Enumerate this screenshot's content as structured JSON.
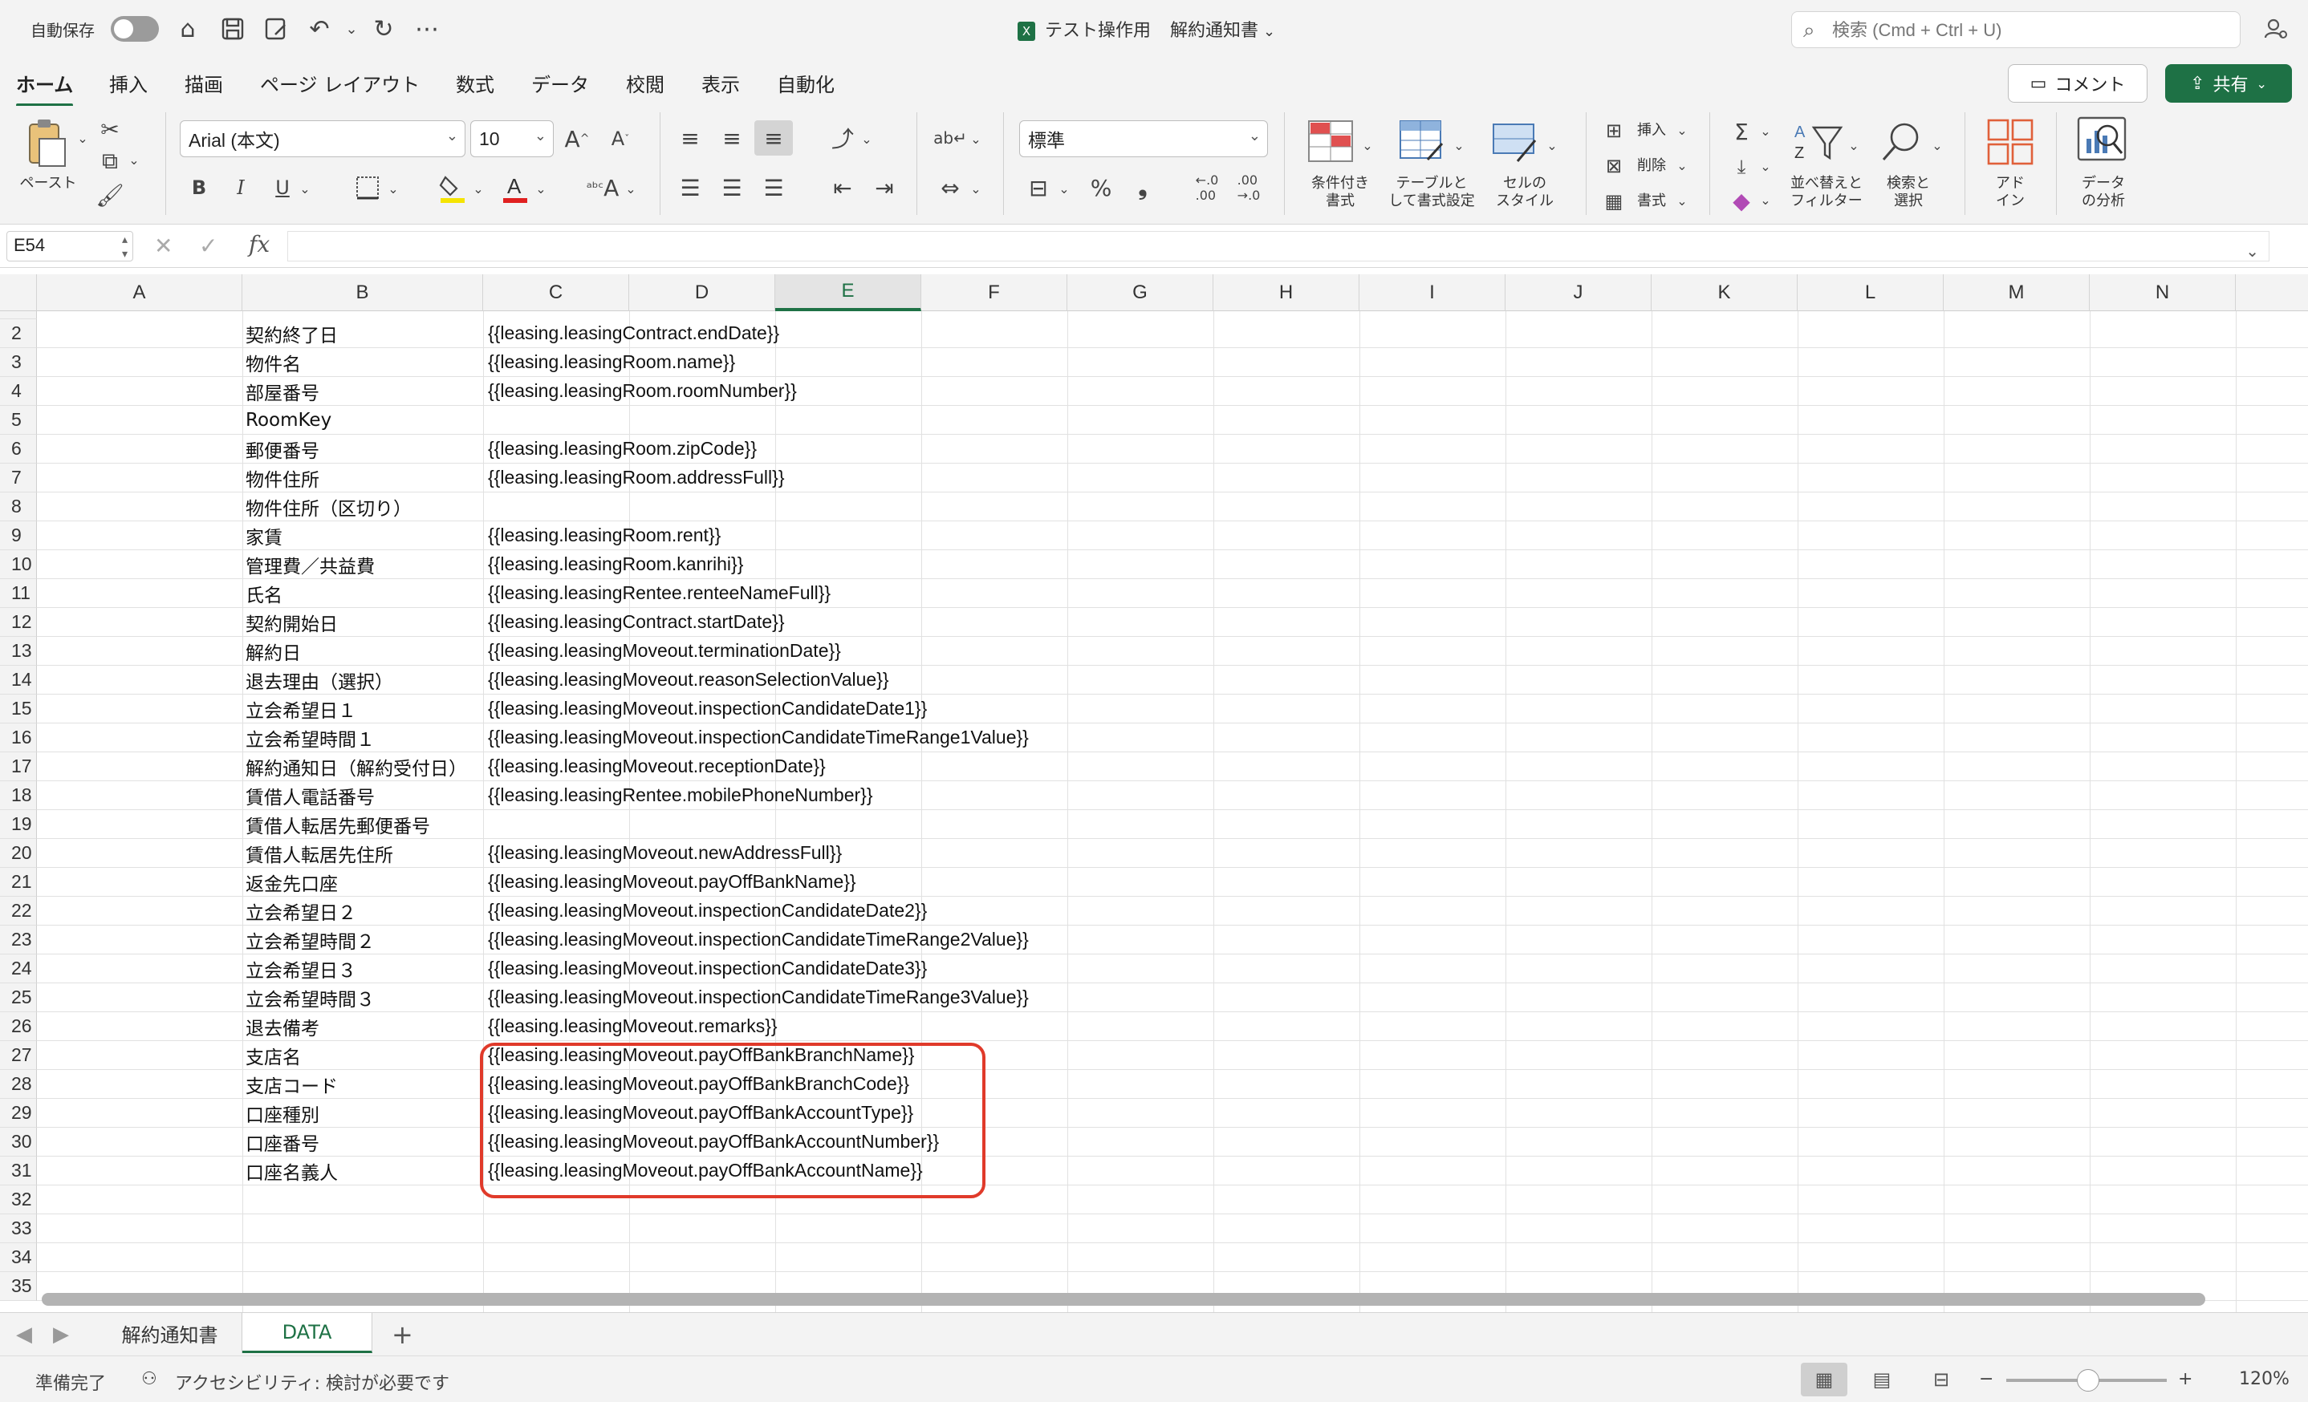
{
  "titlebar": {
    "autosave_label": "自動保存",
    "file_name": "テスト操作用",
    "doc_title": "解約通知書",
    "search_placeholder": "検索 (Cmd + Ctrl + U)"
  },
  "tabs": [
    "ホーム",
    "挿入",
    "描画",
    "ページ レイアウト",
    "数式",
    "データ",
    "校閲",
    "表示",
    "自動化"
  ],
  "active_tab": "ホーム",
  "actions": {
    "comment_label": "コメント",
    "share_label": "共有"
  },
  "ribbon": {
    "paste_label": "ペースト",
    "font_name": "Arial (本文)",
    "font_size": "10",
    "number_format": "標準",
    "conditional_format_label": "条件付き\n書式",
    "table_format_label": "テーブルと\nして書式設定",
    "cell_style_label": "セルの\nスタイル",
    "insert_label": "挿入",
    "delete_label": "削除",
    "format_label": "書式",
    "sort_filter_label": "並べ替えと\nフィルター",
    "find_select_label": "検索と\n選択",
    "addins_label": "アド\nイン",
    "analyze_label": "データ\nの分析"
  },
  "formula_bar": {
    "name_box": "E54",
    "fx_label": "fx",
    "formula": ""
  },
  "columns": [
    "A",
    "B",
    "C",
    "D",
    "E",
    "F",
    "G",
    "H",
    "I",
    "J",
    "K",
    "L",
    "M",
    "N"
  ],
  "selected_column": "E",
  "rows": [
    {
      "n": "2",
      "b": "契約終了日",
      "c": "{{leasing.leasingContract.endDate}}"
    },
    {
      "n": "3",
      "b": "物件名",
      "c": "{{leasing.leasingRoom.name}}"
    },
    {
      "n": "4",
      "b": "部屋番号",
      "c": "{{leasing.leasingRoom.roomNumber}}"
    },
    {
      "n": "5",
      "b": "RoomKey",
      "c": ""
    },
    {
      "n": "6",
      "b": "郵便番号",
      "c": "{{leasing.leasingRoom.zipCode}}"
    },
    {
      "n": "7",
      "b": "物件住所",
      "c": "{{leasing.leasingRoom.addressFull}}"
    },
    {
      "n": "8",
      "b": "物件住所（区切り）",
      "c": ""
    },
    {
      "n": "9",
      "b": "家賃",
      "c": "{{leasing.leasingRoom.rent}}"
    },
    {
      "n": "10",
      "b": "管理費／共益費",
      "c": "{{leasing.leasingRoom.kanrihi}}"
    },
    {
      "n": "11",
      "b": "氏名",
      "c": "{{leasing.leasingRentee.renteeNameFull}}"
    },
    {
      "n": "12",
      "b": "契約開始日",
      "c": "{{leasing.leasingContract.startDate}}"
    },
    {
      "n": "13",
      "b": "解約日",
      "c": "{{leasing.leasingMoveout.terminationDate}}"
    },
    {
      "n": "14",
      "b": "退去理由（選択）",
      "c": "{{leasing.leasingMoveout.reasonSelectionValue}}"
    },
    {
      "n": "15",
      "b": "立会希望日１",
      "c": "{{leasing.leasingMoveout.inspectionCandidateDate1}}"
    },
    {
      "n": "16",
      "b": "立会希望時間１",
      "c": "{{leasing.leasingMoveout.inspectionCandidateTimeRange1Value}}"
    },
    {
      "n": "17",
      "b": "解約通知日（解約受付日）",
      "c": "{{leasing.leasingMoveout.receptionDate}}"
    },
    {
      "n": "18",
      "b": "賃借人電話番号",
      "c": "{{leasing.leasingRentee.mobilePhoneNumber}}"
    },
    {
      "n": "19",
      "b": "賃借人転居先郵便番号",
      "c": ""
    },
    {
      "n": "20",
      "b": "賃借人転居先住所",
      "c": "{{leasing.leasingMoveout.newAddressFull}}"
    },
    {
      "n": "21",
      "b": "返金先口座",
      "c": "{{leasing.leasingMoveout.payOffBankName}}"
    },
    {
      "n": "22",
      "b": "立会希望日２",
      "c": "{{leasing.leasingMoveout.inspectionCandidateDate2}}"
    },
    {
      "n": "23",
      "b": "立会希望時間２",
      "c": "{{leasing.leasingMoveout.inspectionCandidateTimeRange2Value}}"
    },
    {
      "n": "24",
      "b": "立会希望日３",
      "c": "{{leasing.leasingMoveout.inspectionCandidateDate3}}"
    },
    {
      "n": "25",
      "b": "立会希望時間３",
      "c": "{{leasing.leasingMoveout.inspectionCandidateTimeRange3Value}}"
    },
    {
      "n": "26",
      "b": "退去備考",
      "c": "{{leasing.leasingMoveout.remarks}}"
    },
    {
      "n": "27",
      "b": "支店名",
      "c": "{{leasing.leasingMoveout.payOffBankBranchName}}"
    },
    {
      "n": "28",
      "b": "支店コード",
      "c": "{{leasing.leasingMoveout.payOffBankBranchCode}}"
    },
    {
      "n": "29",
      "b": "口座種別",
      "c": "{{leasing.leasingMoveout.payOffBankAccountType}}"
    },
    {
      "n": "30",
      "b": "口座番号",
      "c": "{{leasing.leasingMoveout.payOffBankAccountNumber}}"
    },
    {
      "n": "31",
      "b": "口座名義人",
      "c": "{{leasing.leasingMoveout.payOffBankAccountName}}"
    },
    {
      "n": "32",
      "b": "",
      "c": ""
    },
    {
      "n": "33",
      "b": "",
      "c": ""
    },
    {
      "n": "34",
      "b": "",
      "c": ""
    },
    {
      "n": "35",
      "b": "",
      "c": ""
    }
  ],
  "sheets": [
    "解約通知書",
    "DATA"
  ],
  "active_sheet": "DATA",
  "status": {
    "ready": "準備完了",
    "accessibility": "アクセシビリティ: 検討が必要です",
    "zoom": "120%"
  },
  "colors": {
    "accent": "#1e7145",
    "highlight": "#e03a2a"
  }
}
